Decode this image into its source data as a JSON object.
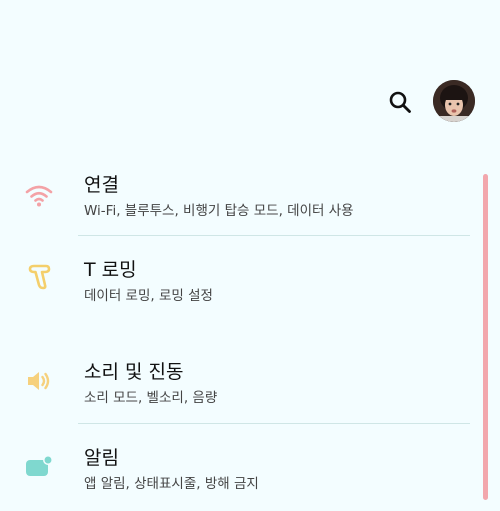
{
  "header": {
    "search_icon": "search-icon",
    "avatar_icon": "profile-avatar"
  },
  "settings": {
    "items": [
      {
        "title": "연결",
        "subtitle": "Wi-Fi, 블루투스, 비행기 탑승 모드, 데이터 사용",
        "icon": "wifi-icon",
        "color": "#f3a2a6"
      },
      {
        "title": "T 로밍",
        "subtitle": "데이터 로밍, 로밍 설정",
        "icon": "t-roaming-icon",
        "color": "#f4cf6b"
      },
      {
        "title": "소리 및 진동",
        "subtitle": "소리 모드, 벨소리, 음량",
        "icon": "speaker-icon",
        "color": "#f6d17d"
      },
      {
        "title": "알림",
        "subtitle": "앱 알림, 상태표시줄, 방해 금지",
        "icon": "notification-icon",
        "color": "#7fd8cf"
      }
    ]
  },
  "colors": {
    "background": "#f3fdff",
    "scrollbar": "#f2a7ad",
    "divider": "#cfe6e6"
  }
}
